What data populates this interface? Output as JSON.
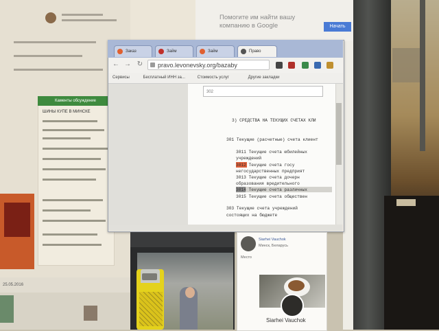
{
  "background_panel": {
    "status_text": "25.05.2016",
    "green_header": "Каменты обсуждение",
    "green_heading": "ШИНЫ КУПЕ В МИНСКЕ"
  },
  "top_web": {
    "headline_line1": "Помогите им найти вашу",
    "headline_line2": "компанию в Google",
    "button_label": "Начать"
  },
  "chrome": {
    "tabs": [
      {
        "label": "Заказ"
      },
      {
        "label": "Займ"
      },
      {
        "label": "Займ"
      },
      {
        "label": "Право"
      }
    ],
    "url": "pravo.levonevsky.org/bazaby",
    "bookmarks": [
      "Сервисы",
      "Бесплатный ИНН за...",
      "Стоимость услуг",
      "Другие закладки"
    ],
    "find_query": "302"
  },
  "document": {
    "lines": [
      "3) СРЕДСТВА НА ТЕКУЩИХ СЧЕТАХ КЛИ",
      "301 Текущие (расчетные) счета клиент",
      "3011 Текущие  счета  юбилейных",
      "     учреждений",
      "3012 Текущие   счета   госу",
      "     негосударственных предприят",
      "3013 Текущие   счета   дочерн",
      "     образования вредительного",
      "3014 Текущие счета различных",
      "3015 Текущие счета обществен",
      "303 Текущие  счета  учреждений",
      "     состоящих на бюджете"
    ]
  },
  "fb_panel": {
    "lines": [
      "Siarhei Vauchok",
      "Минск, Беларусь",
      "Место"
    ],
    "name": "Siarhei Vauchok"
  },
  "colors": {
    "chrome_tabstrip": "#a9b8d6",
    "highlight_red": "#e0603a",
    "green_panel": "#3e8a3e",
    "lighter_yellow": "#e4d21c"
  }
}
